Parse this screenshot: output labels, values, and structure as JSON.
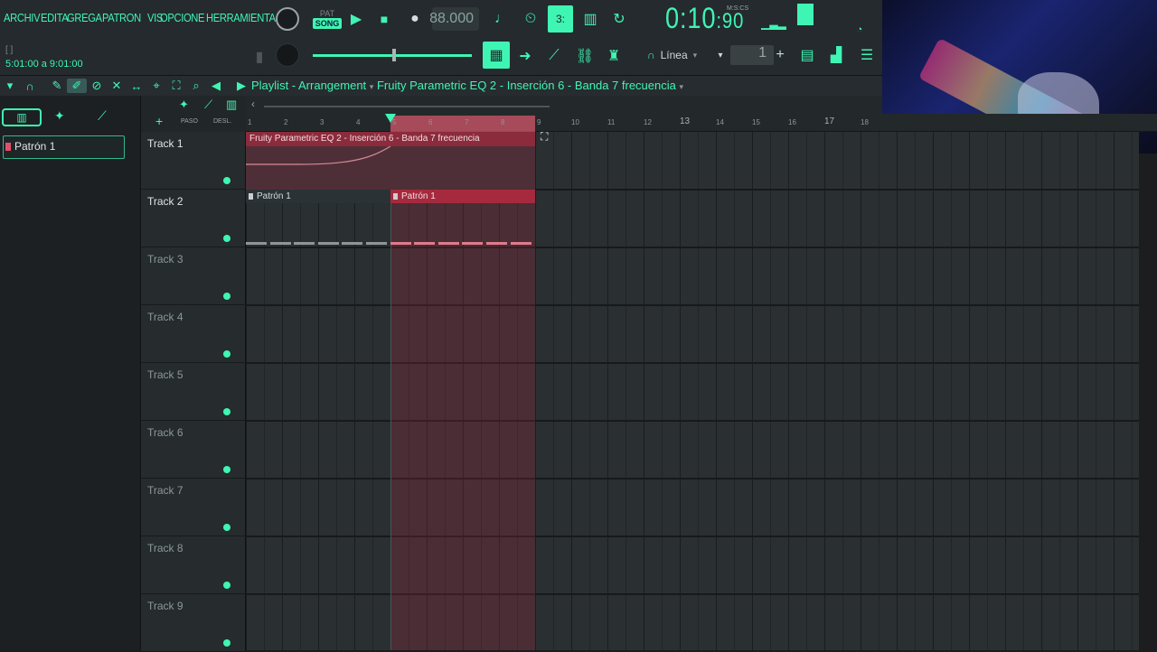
{
  "menu": [
    "ARCHIV",
    "EDITA",
    "GREGA",
    "PATRON",
    "VIS",
    "OPCIONE",
    "HERRAMIENTA"
  ],
  "transport": {
    "pat_label": "PAT",
    "song_label": "SONG",
    "tempo": "88.000",
    "time_main": "0:10",
    "time_cs": ":90",
    "time_format": "M:S:CS",
    "hint_bracket": "[  ]",
    "hint_range": "5:01:00 a 9:01:00",
    "snap": "Línea",
    "step_value": "1"
  },
  "playlist": {
    "title": "Playlist - Arrangement",
    "target": "Fruity Parametric EQ 2 - Inserción 6 - Banda 7 frecuencia"
  },
  "picker": {
    "pattern": "Patrón 1"
  },
  "header": {
    "paso": "PASO",
    "desl": "DESL."
  },
  "ruler": [
    "1",
    "2",
    "3",
    "4",
    "5",
    "6",
    "7",
    "8",
    "9",
    "10",
    "11",
    "12",
    "13",
    "14",
    "15",
    "16",
    "17",
    "18"
  ],
  "tracks": [
    {
      "name": "Track 1",
      "active": true
    },
    {
      "name": "Track 2",
      "active": true
    },
    {
      "name": "Track 3",
      "active": false
    },
    {
      "name": "Track 4",
      "active": false
    },
    {
      "name": "Track 5",
      "active": false
    },
    {
      "name": "Track 6",
      "active": false
    },
    {
      "name": "Track 7",
      "active": false
    },
    {
      "name": "Track 8",
      "active": false
    },
    {
      "name": "Track 9",
      "active": false
    }
  ],
  "clips": {
    "automation": "Fruity Parametric EQ 2 - Inserción 6 - Banda 7 frecuencia",
    "pattern_a": "Patrón 1",
    "pattern_b": "Patrón 1"
  },
  "colors": {
    "accent": "#3ff5b4",
    "selection": "#d4556a",
    "clip_red": "#a52a3e"
  }
}
